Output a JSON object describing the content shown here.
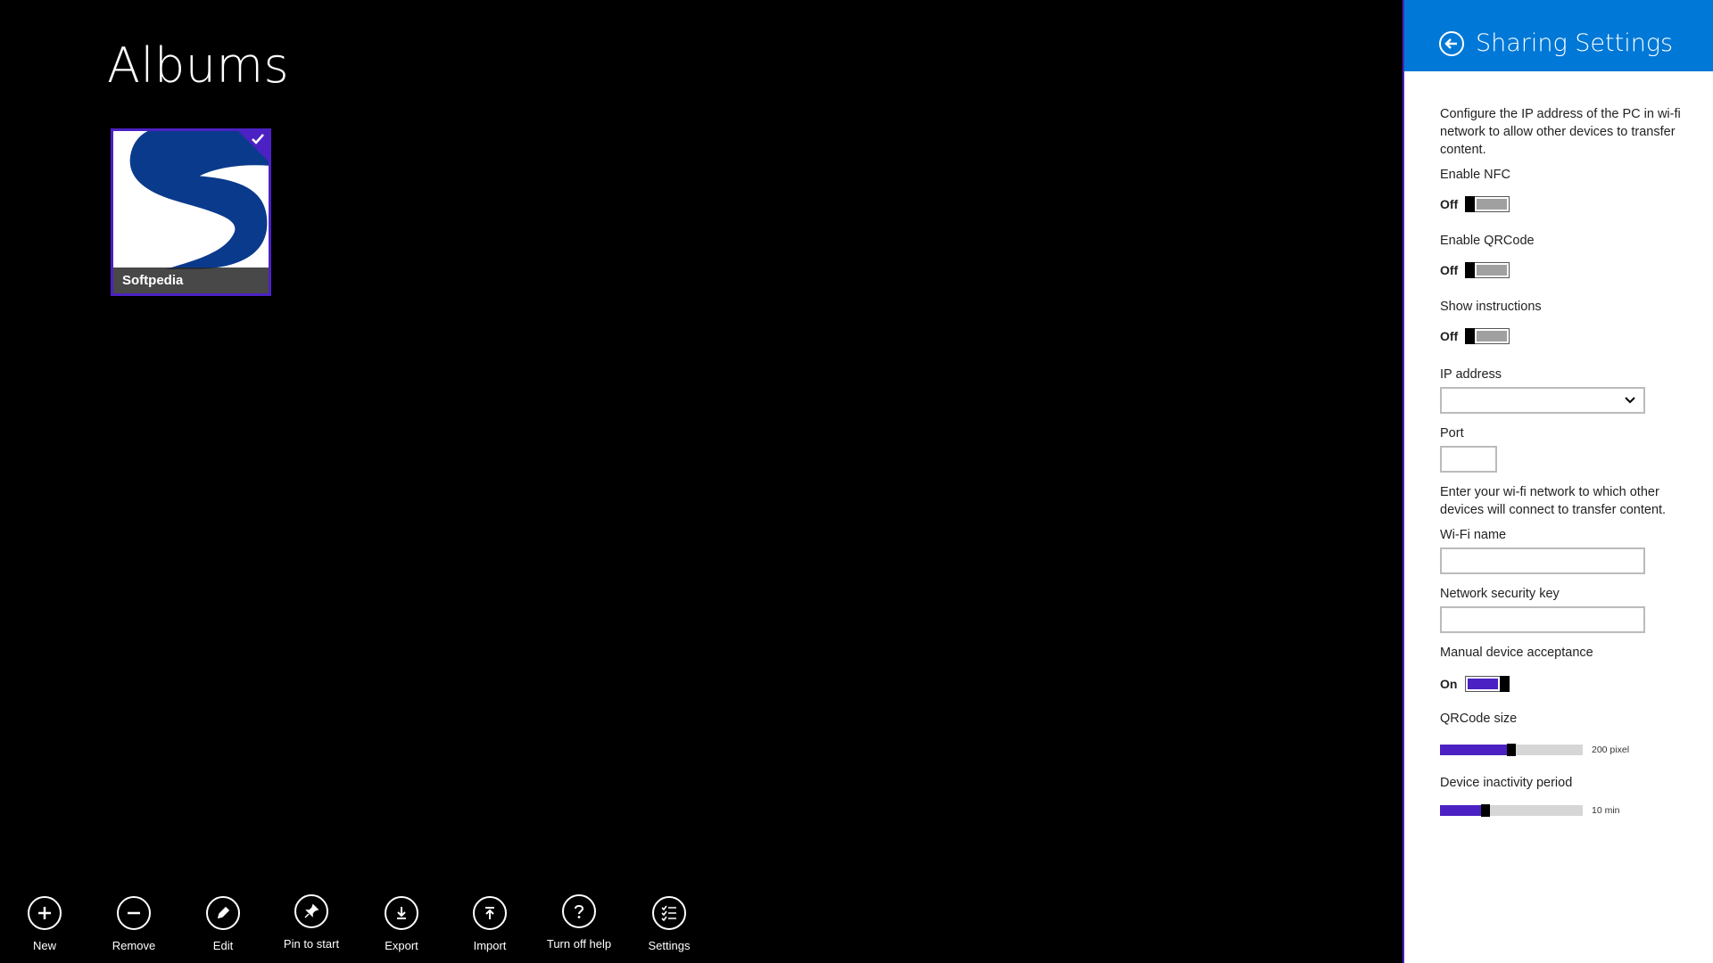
{
  "page": {
    "title": "Albums"
  },
  "albums": [
    {
      "name": "Softpedia",
      "selected": true
    }
  ],
  "appbar": [
    {
      "label": "New",
      "icon": "plus-icon"
    },
    {
      "label": "Remove",
      "icon": "minus-icon"
    },
    {
      "label": "Edit",
      "icon": "pencil-icon"
    },
    {
      "label": "Pin to start",
      "icon": "pin-icon"
    },
    {
      "label": "Export",
      "icon": "download-icon"
    },
    {
      "label": "Import",
      "icon": "upload-icon"
    },
    {
      "label": "Turn off help",
      "icon": "question-icon"
    },
    {
      "label": "Settings",
      "icon": "checklist-icon"
    }
  ],
  "pane": {
    "title": "Sharing Settings",
    "intro": "Configure the IP address of the PC in wi-fi network to allow other devices to transfer content.",
    "enable_nfc": {
      "label": "Enable NFC",
      "state": "Off"
    },
    "enable_qrcode": {
      "label": "Enable QRCode",
      "state": "Off"
    },
    "show_instructions": {
      "label": "Show instructions",
      "state": "Off"
    },
    "ip_address": {
      "label": "IP address",
      "value": ""
    },
    "port": {
      "label": "Port",
      "value": ""
    },
    "wifi_intro": "Enter your wi-fi network to which other devices will connect to transfer content.",
    "wifi_name": {
      "label": "Wi-Fi name",
      "value": ""
    },
    "security_key": {
      "label": "Network security key",
      "value": ""
    },
    "manual_acceptance": {
      "label": "Manual device acceptance",
      "state": "On"
    },
    "qrcode_size": {
      "label": "QRCode size",
      "value_text": "200 pixel",
      "level": 0.5
    },
    "inactivity": {
      "label": "Device inactivity period",
      "value_text": "10 min",
      "level": 0.32
    }
  },
  "colors": {
    "accent": "#4b21c3",
    "header": "#0078d7",
    "background": "#000000"
  }
}
